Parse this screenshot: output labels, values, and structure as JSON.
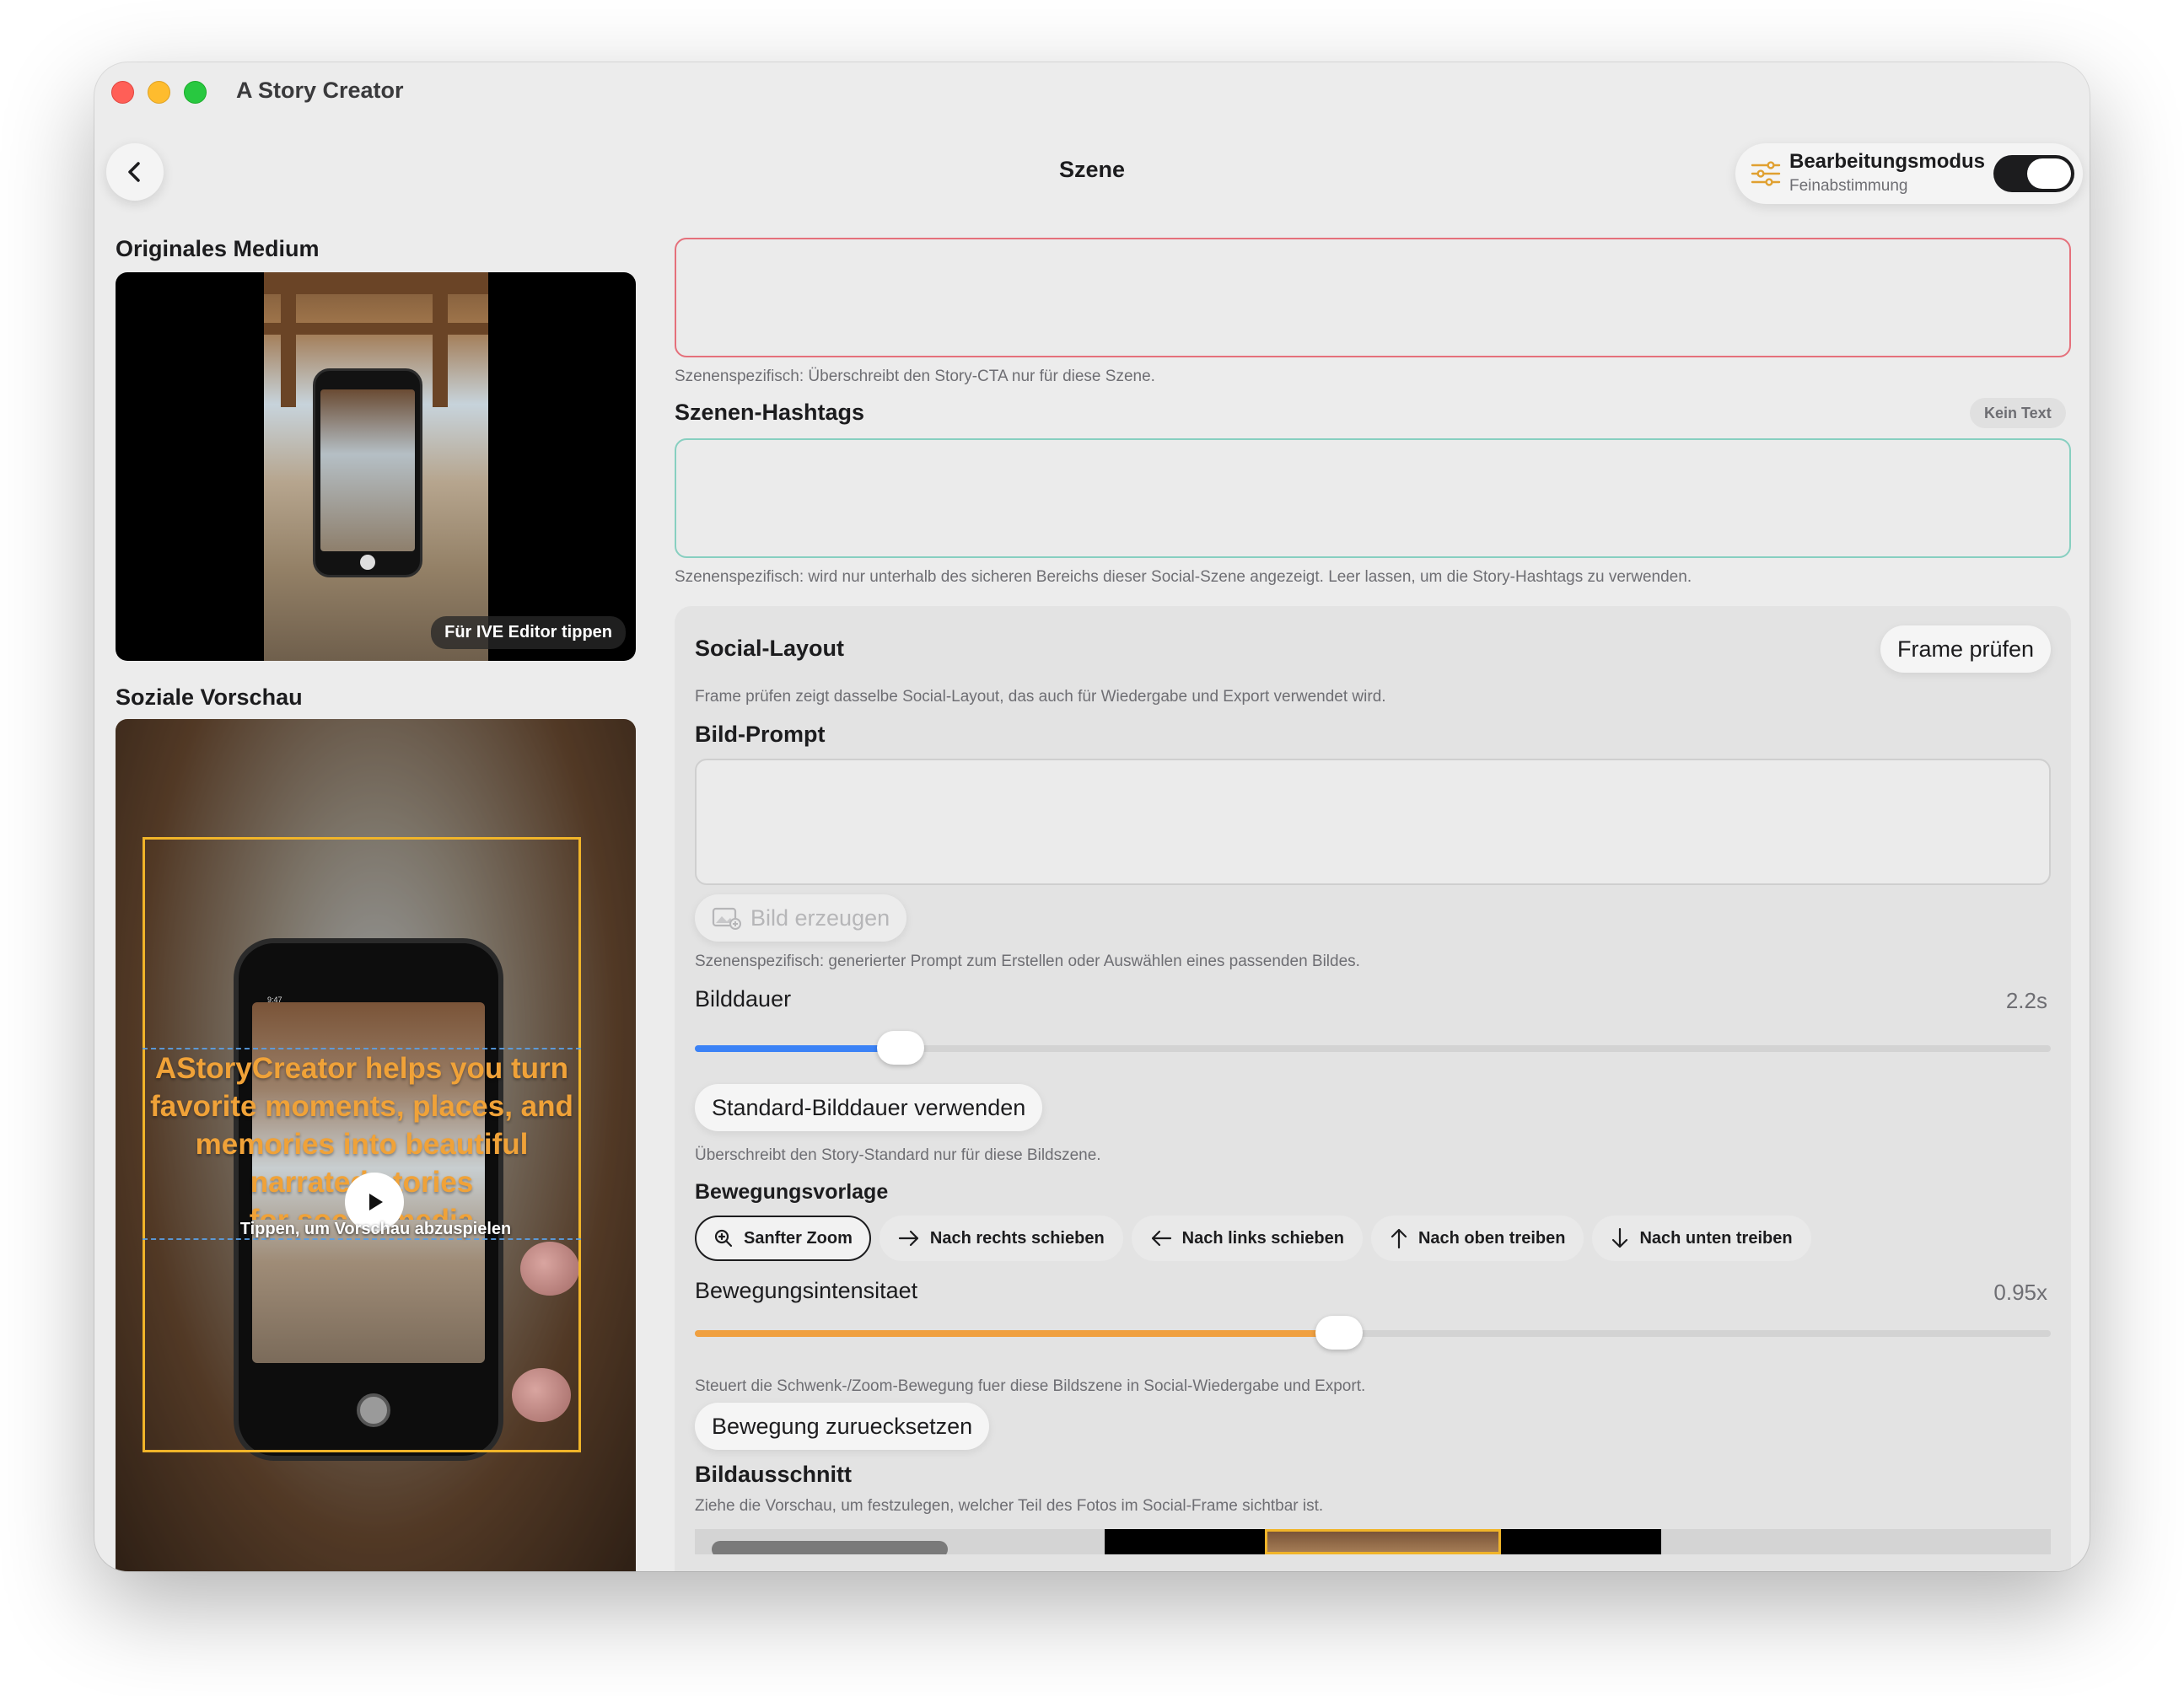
{
  "window": {
    "title": "A Story Creator"
  },
  "header": {
    "title": "Szene",
    "edit_mode": {
      "label": "Bearbeitungsmodus",
      "sublabel": "Feinabstimmung",
      "on": true
    }
  },
  "left": {
    "original_label": "Originales Medium",
    "original_tag": "Für IVE Editor tippen",
    "preview_label": "Soziale Vorschau",
    "preview_caption": "AStoryCreator helps you turn favorite moments, places, and memories into beautiful narrated stories",
    "preview_caption_tail": "for social media",
    "preview_tap_hint": "Tippen, um Vorschau abzuspielen",
    "phone_time": "9:47"
  },
  "cta": {
    "hint": "Szenenspezifisch: Überschreibt den Story-CTA nur für diese Szene."
  },
  "hashtags": {
    "label": "Szenen-Hashtags",
    "badge": "Kein Text",
    "hint": "Szenenspezifisch: wird nur unterhalb des sicheren Bereichs dieser Social-Szene angezeigt. Leer lassen, um die Story-Hashtags zu verwenden."
  },
  "social_layout": {
    "title": "Social-Layout",
    "check_button": "Frame prüfen",
    "hint": "Frame prüfen zeigt dasselbe Social-Layout, das auch für Wiedergabe und Export verwendet wird.",
    "image_prompt_label": "Bild-Prompt",
    "generate_button": "Bild erzeugen",
    "prompt_hint": "Szenenspezifisch: generierter Prompt zum Erstellen oder Auswählen eines passenden Bildes.",
    "duration_label": "Bilddauer",
    "duration_value": "2.2s",
    "duration_fraction": 0.152,
    "default_duration_button": "Standard-Bilddauer verwenden",
    "duration_hint": "Überschreibt den Story-Standard nur für diese Bildszene.",
    "motion_label": "Bewegungsvorlage",
    "motion_presets": [
      {
        "label": "Sanfter Zoom",
        "icon": "zoom-icon",
        "selected": true
      },
      {
        "label": "Nach rechts schieben",
        "icon": "arrow-right-icon",
        "selected": false
      },
      {
        "label": "Nach links schieben",
        "icon": "arrow-left-icon",
        "selected": false
      },
      {
        "label": "Nach oben treiben",
        "icon": "arrow-up-icon",
        "selected": false
      },
      {
        "label": "Nach unten treiben",
        "icon": "arrow-down-icon",
        "selected": false
      }
    ],
    "intensity_label": "Bewegungsintensitaet",
    "intensity_value": "0.95x",
    "intensity_fraction": 0.475,
    "intensity_hint": "Steuert die Schwenk-/Zoom-Bewegung fuer diese Bildszene in Social-Wiedergabe und Export.",
    "reset_motion_button": "Bewegung zuruecksetzen",
    "crop_label": "Bildausschnitt",
    "crop_hint": "Ziehe die Vorschau, um festzulegen, welcher Teil des Fotos im Social-Frame sichtbar ist."
  },
  "colors": {
    "accent_blue": "#3b82f6",
    "accent_orange": "#f0a040",
    "safe_area": "#f0b429",
    "error_border": "#e5707b",
    "teal_border": "#87cfc0"
  }
}
